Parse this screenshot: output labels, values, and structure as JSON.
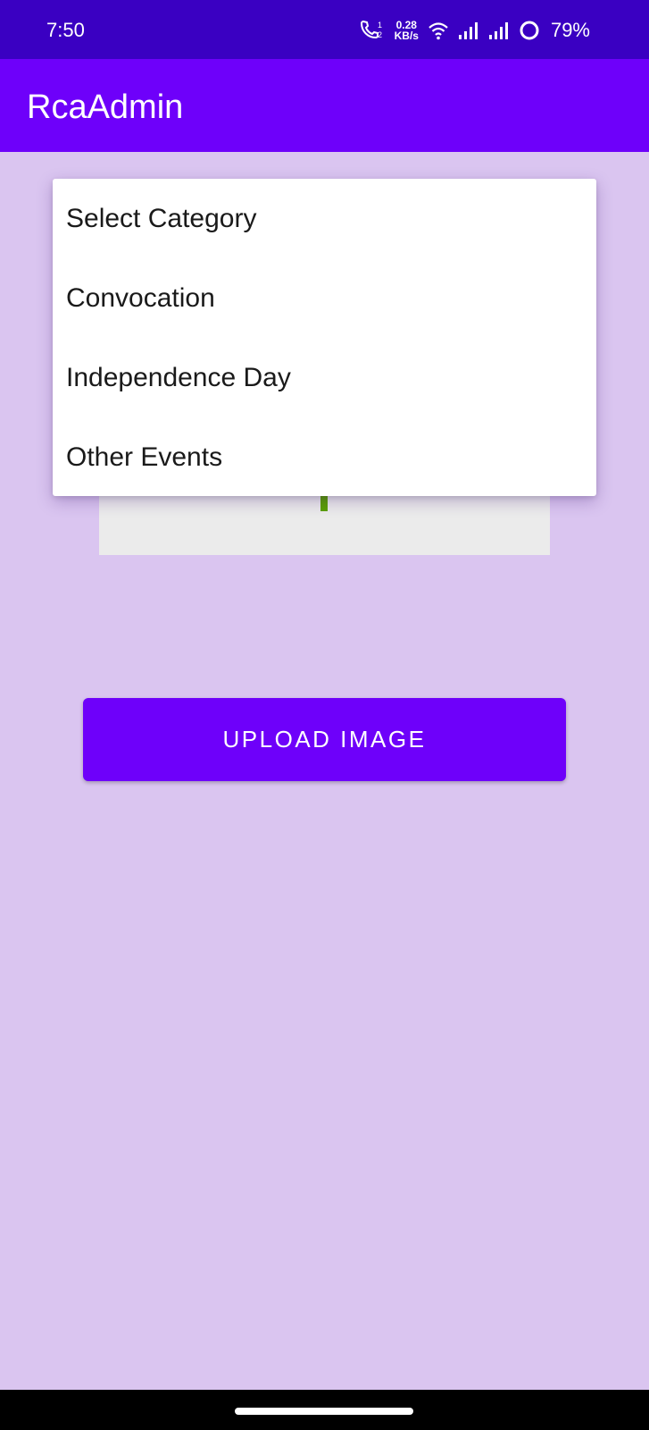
{
  "status_bar": {
    "time": "7:50",
    "network_speed_value": "0.28",
    "network_speed_unit": "KB/s",
    "battery_percent": "79%",
    "icons": [
      "volte-call-icon",
      "wifi-icon",
      "signal-icon",
      "signal-icon",
      "battery-ring-icon"
    ]
  },
  "app_bar": {
    "title": "RcaAdmin"
  },
  "category_dropdown": {
    "options": [
      "Select Category",
      "Convocation",
      "Independence Day",
      "Other Events"
    ]
  },
  "image_picker": {
    "icon": "add-image-plus-icon"
  },
  "upload_button": {
    "label": "UPLOAD IMAGE"
  },
  "colors": {
    "status_bar": "#3A00C2",
    "app_bar": "#6E00FA",
    "background": "#DAC5F0",
    "button": "#6E00FA",
    "plus_icon": "#5AA000"
  }
}
